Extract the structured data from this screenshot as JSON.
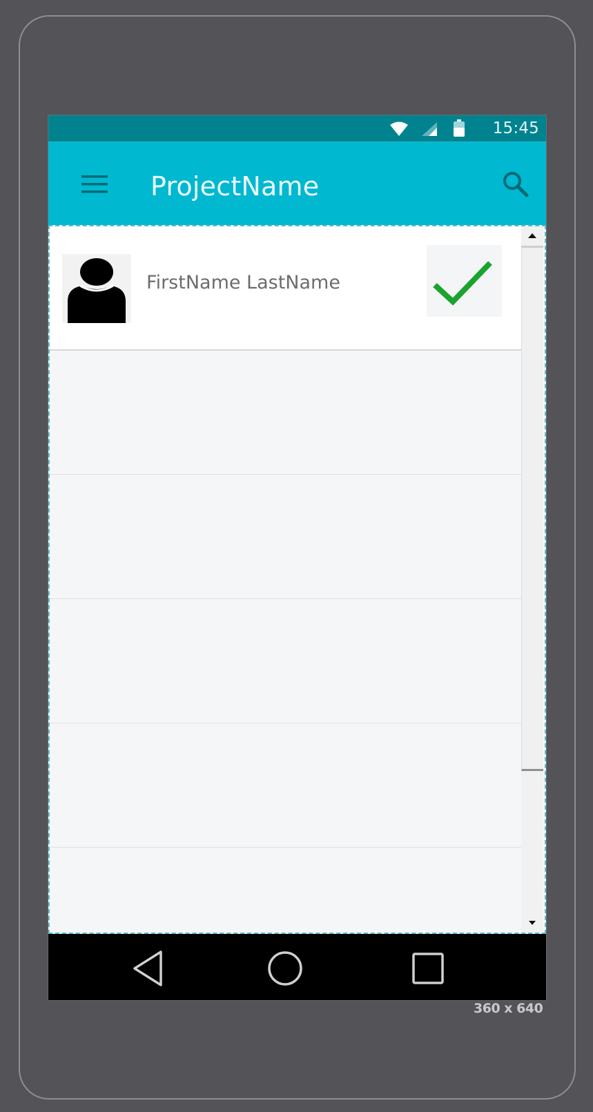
{
  "status_bar": {
    "time": "15:45",
    "icons": [
      "wifi-icon",
      "cell-signal-icon",
      "battery-icon"
    ]
  },
  "app_bar": {
    "title": "ProjectName",
    "menu_icon": "hamburger-menu-icon",
    "search_icon": "search-icon"
  },
  "list": {
    "rows": [
      {
        "name": "FirstName LastName",
        "avatar_icon": "person-icon",
        "action_icon": "check-icon",
        "checked": true
      }
    ],
    "empty_rows": 4
  },
  "scrollbar": {
    "up_icon": "scroll-up-arrow-icon",
    "down_icon": "scroll-down-arrow-icon"
  },
  "nav_bar": {
    "icons": [
      "back-icon",
      "home-icon",
      "recents-icon"
    ]
  },
  "device": {
    "size_label": "360 x 640"
  },
  "colors": {
    "status_bar": "#00838f",
    "app_bar": "#00b8d0",
    "check_green": "#1aa32e",
    "background": "#535358"
  }
}
